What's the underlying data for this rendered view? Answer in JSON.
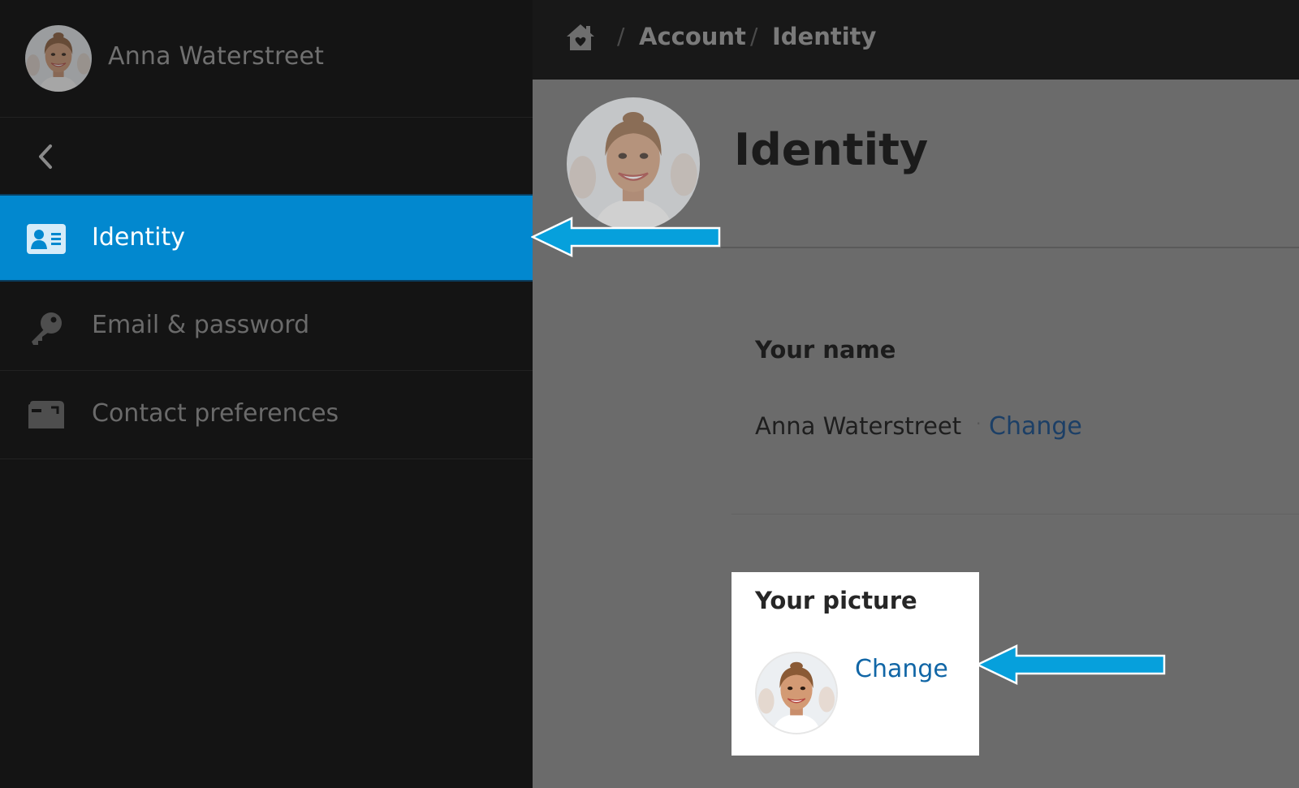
{
  "sidebar": {
    "user_name": "Anna Waterstreet",
    "back_icon": "chevron-left-icon",
    "items": [
      {
        "label": "Identity",
        "icon": "id-card-icon",
        "active": true
      },
      {
        "label": "Email & password",
        "icon": "key-icon",
        "active": false
      },
      {
        "label": "Contact preferences",
        "icon": "mailbox-icon",
        "active": false
      }
    ]
  },
  "breadcrumb": {
    "home_icon": "home-icon",
    "separator": "/",
    "items": [
      "Account",
      "Identity"
    ]
  },
  "main": {
    "title": "Identity",
    "name_section": {
      "heading": "Your name",
      "value": "Anna Waterstreet",
      "separator": "·",
      "change_label": "Change"
    },
    "picture_section": {
      "heading": "Your picture",
      "change_label": "Change"
    }
  },
  "colors": {
    "accent": "#0288cf",
    "arrow": "#06a0dc",
    "link": "#1166a6",
    "sidebar_bg": "#141414",
    "overlay_bg": "#6b6b6b"
  }
}
